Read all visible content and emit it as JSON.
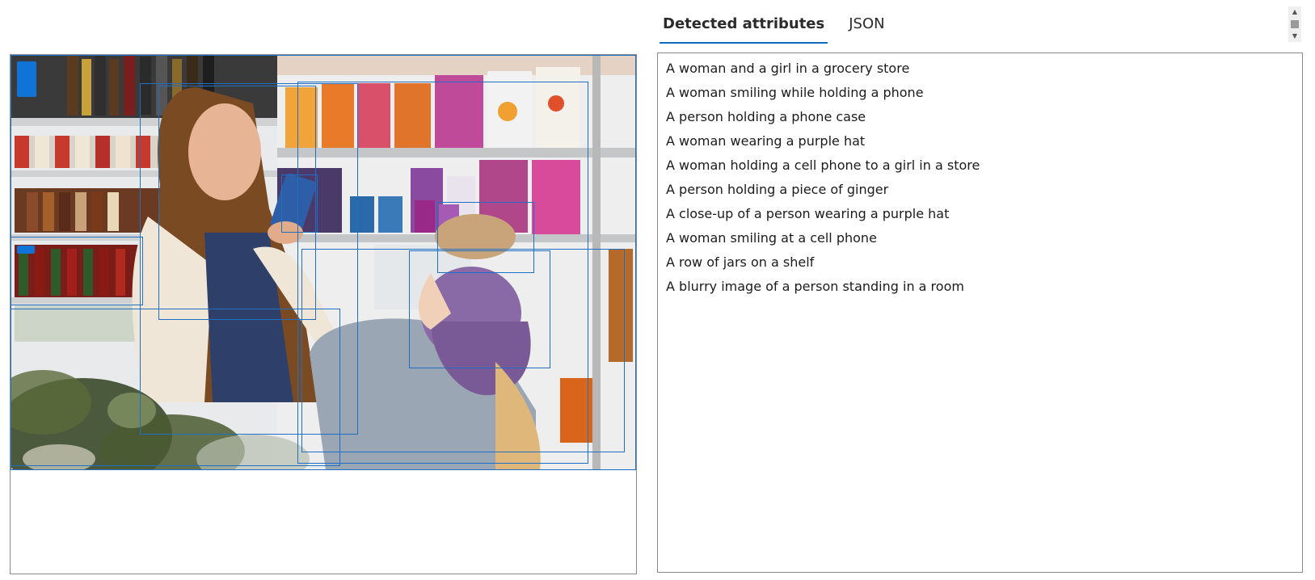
{
  "tabs": [
    {
      "label": "Detected attributes",
      "active": true
    },
    {
      "label": "JSON",
      "active": false
    }
  ],
  "attributes": [
    "A woman and a girl in a grocery store",
    "A woman smiling while holding a phone",
    "A person holding a phone case",
    "A woman wearing a purple hat",
    "A woman holding a cell phone to a girl in a store",
    "A person holding a piece of ginger",
    "A close-up of a person wearing a purple hat",
    "A woman smiling at a cell phone",
    "A row of jars on a shelf",
    "A blurry image of a person standing in a room"
  ],
  "colors": {
    "bbox": "#1f6fc4",
    "tab_active_underline": "#0f6cbd",
    "panel_border": "#8a8a8a"
  },
  "icons": [
    "scroll-up-icon",
    "scroll-down-icon"
  ]
}
